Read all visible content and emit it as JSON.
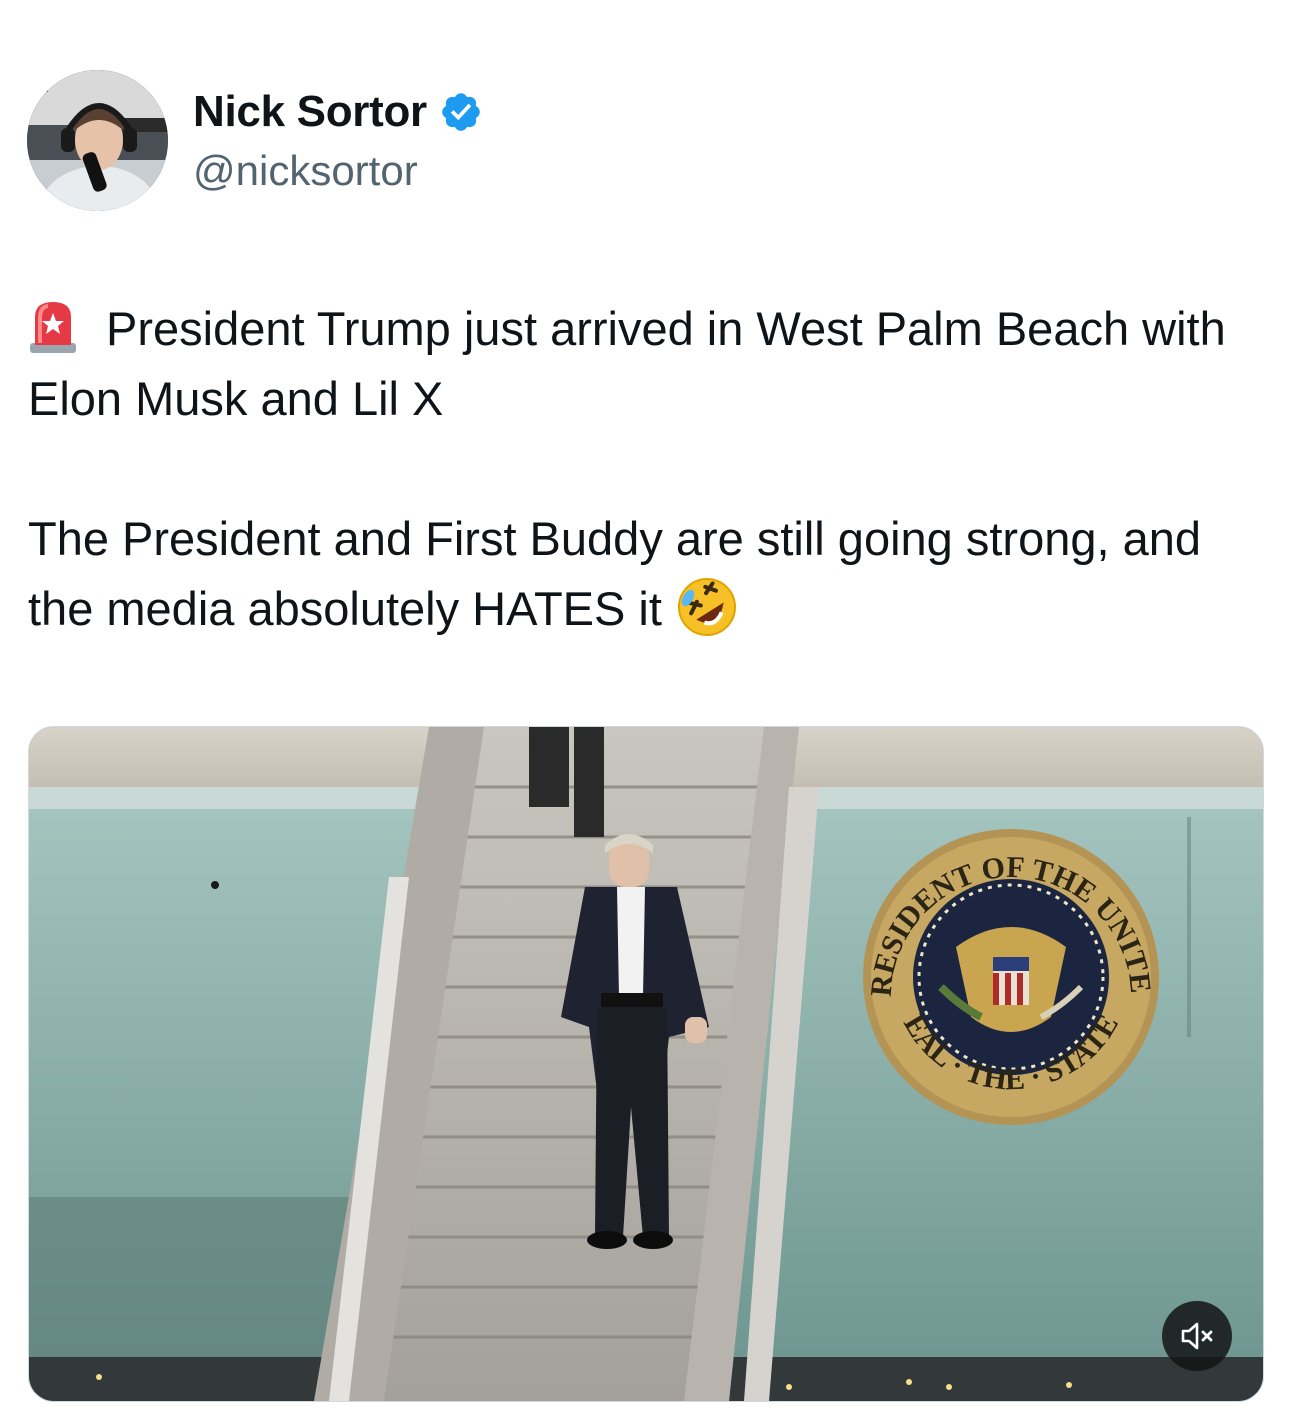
{
  "author": {
    "display_name": "Nick Sortor",
    "handle": "@nicksortor",
    "verified": true,
    "verified_color": "#1d9bf0",
    "avatar_icon": "avatar-photo"
  },
  "tweet": {
    "line1": "President Trump just arrived in West Palm Beach with Elon Musk and Lil X",
    "line2": "The President and First Buddy are still going strong, and the media absolutely HATES it",
    "lead_emoji": "police-light-emoji",
    "trail_emoji": "rolling-on-floor-laughing-emoji"
  },
  "media": {
    "type": "video",
    "seal_text_top": "PRESIDENT OF THE UNITED",
    "seal_text_bottom": "SEAL · THE · STATES",
    "mute_icon": "speaker-muted-icon"
  }
}
